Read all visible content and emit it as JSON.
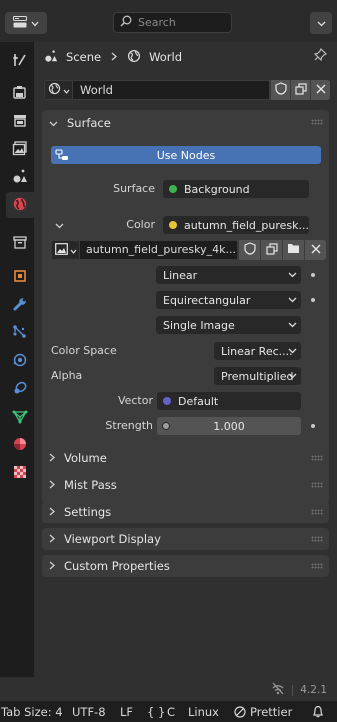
{
  "topbar": {
    "search_placeholder": "Search",
    "editor_type_icon": "properties-editor-icon",
    "menu_icon": "chevron-down-icon"
  },
  "tabs": [
    {
      "name": "tool-tab",
      "icon": "tool-icon"
    },
    {
      "name": "render-tab",
      "icon": "camera-back-icon"
    },
    {
      "name": "output-tab",
      "icon": "printer-icon"
    },
    {
      "name": "view-layer-tab",
      "icon": "image-icon"
    },
    {
      "name": "scene-tab",
      "icon": "scene-icon"
    },
    {
      "name": "world-tab",
      "icon": "world-icon",
      "active": true
    },
    {
      "name": "collection-tab",
      "icon": "collection-box-icon"
    },
    {
      "name": "object-tab",
      "icon": "object-square-icon"
    },
    {
      "name": "modifiers-tab",
      "icon": "wrench-icon"
    },
    {
      "name": "particles-tab",
      "icon": "particles-icon"
    },
    {
      "name": "physics-tab",
      "icon": "physics-orbit-icon"
    },
    {
      "name": "constraints-tab",
      "icon": "constraint-icon"
    },
    {
      "name": "data-tab",
      "icon": "mesh-data-icon"
    },
    {
      "name": "material-tab",
      "icon": "material-sphere-icon"
    },
    {
      "name": "texture-tab",
      "icon": "checker-texture-icon"
    }
  ],
  "breadcrumb": {
    "scene": "Scene",
    "world": "World"
  },
  "world_selector": {
    "name": "World"
  },
  "surface_panel": {
    "title": "Surface",
    "use_nodes": "Use Nodes",
    "surface_label": "Surface",
    "surface_value": "Background",
    "color_label": "Color",
    "color_value": "autumn_field_puresk...",
    "image_name": "autumn_field_puresky_4k....",
    "interpolation": "Linear",
    "projection": "Equirectangular",
    "source": "Single Image",
    "color_space_label": "Color Space",
    "color_space_value": "Linear Rec....",
    "alpha_label": "Alpha",
    "alpha_value": "Premultiplied",
    "vector_label": "Vector",
    "vector_value": "Default",
    "strength_label": "Strength",
    "strength_value": "1.000"
  },
  "collapsed_panels": [
    "Volume",
    "Mist Pass",
    "Settings",
    "Viewport Display",
    "Custom Properties"
  ],
  "version": "4.2.1",
  "statusbar": {
    "tab_size": "Tab Size: 4",
    "encoding": "UTF-8",
    "eol": "LF",
    "language": "C",
    "braces": "{ }",
    "os": "Linux",
    "prettier": "Prettier"
  },
  "colors": {
    "accent": "#4772b3",
    "background_dot": "#3fb34f",
    "color_dot": "#e3c535",
    "vector_dot": "#6363c7"
  }
}
